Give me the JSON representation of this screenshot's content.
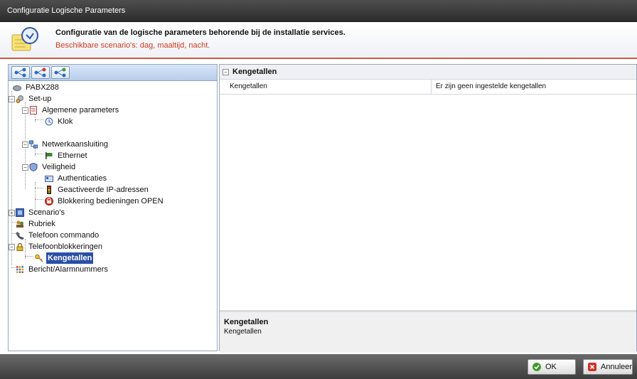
{
  "window": {
    "title": "Configuratie Logische Parameters"
  },
  "header": {
    "title": "Configuratie van de logische parameters behorende bij de installatie services.",
    "subtitle": "Beschikbare scenario's: dag, maaltijd, nacht."
  },
  "tree": {
    "root": "PABX288",
    "setup": "Set-up",
    "algemene": "Algemene parameters",
    "klok": "Klok",
    "netwerk": "Netwerkaansluiting",
    "ethernet": "Ethernet",
    "veiligheid": "Veiligheid",
    "authenticaties": "Authenticaties",
    "ip": "Geactiveerde IP-adressen",
    "blokkering": "Blokkering bedieningen OPEN",
    "scenarios": "Scenario's",
    "rubriek": "Rubriek",
    "telefooncmd": "Telefoon commando",
    "telefoonblok": "Telefoonblokkeringen",
    "kengetallen": "Kengetallen",
    "bericht": "Bericht/Alarmnummers"
  },
  "properties": {
    "category": "Kengetallen",
    "row_name": "Kengetallen",
    "row_value": "Er zijn geen ingestelde kengetallen",
    "desc_title": "Kengetallen",
    "desc_text": "Kengetallen"
  },
  "buttons": {
    "ok": "OK",
    "cancel": "Annuleer"
  }
}
